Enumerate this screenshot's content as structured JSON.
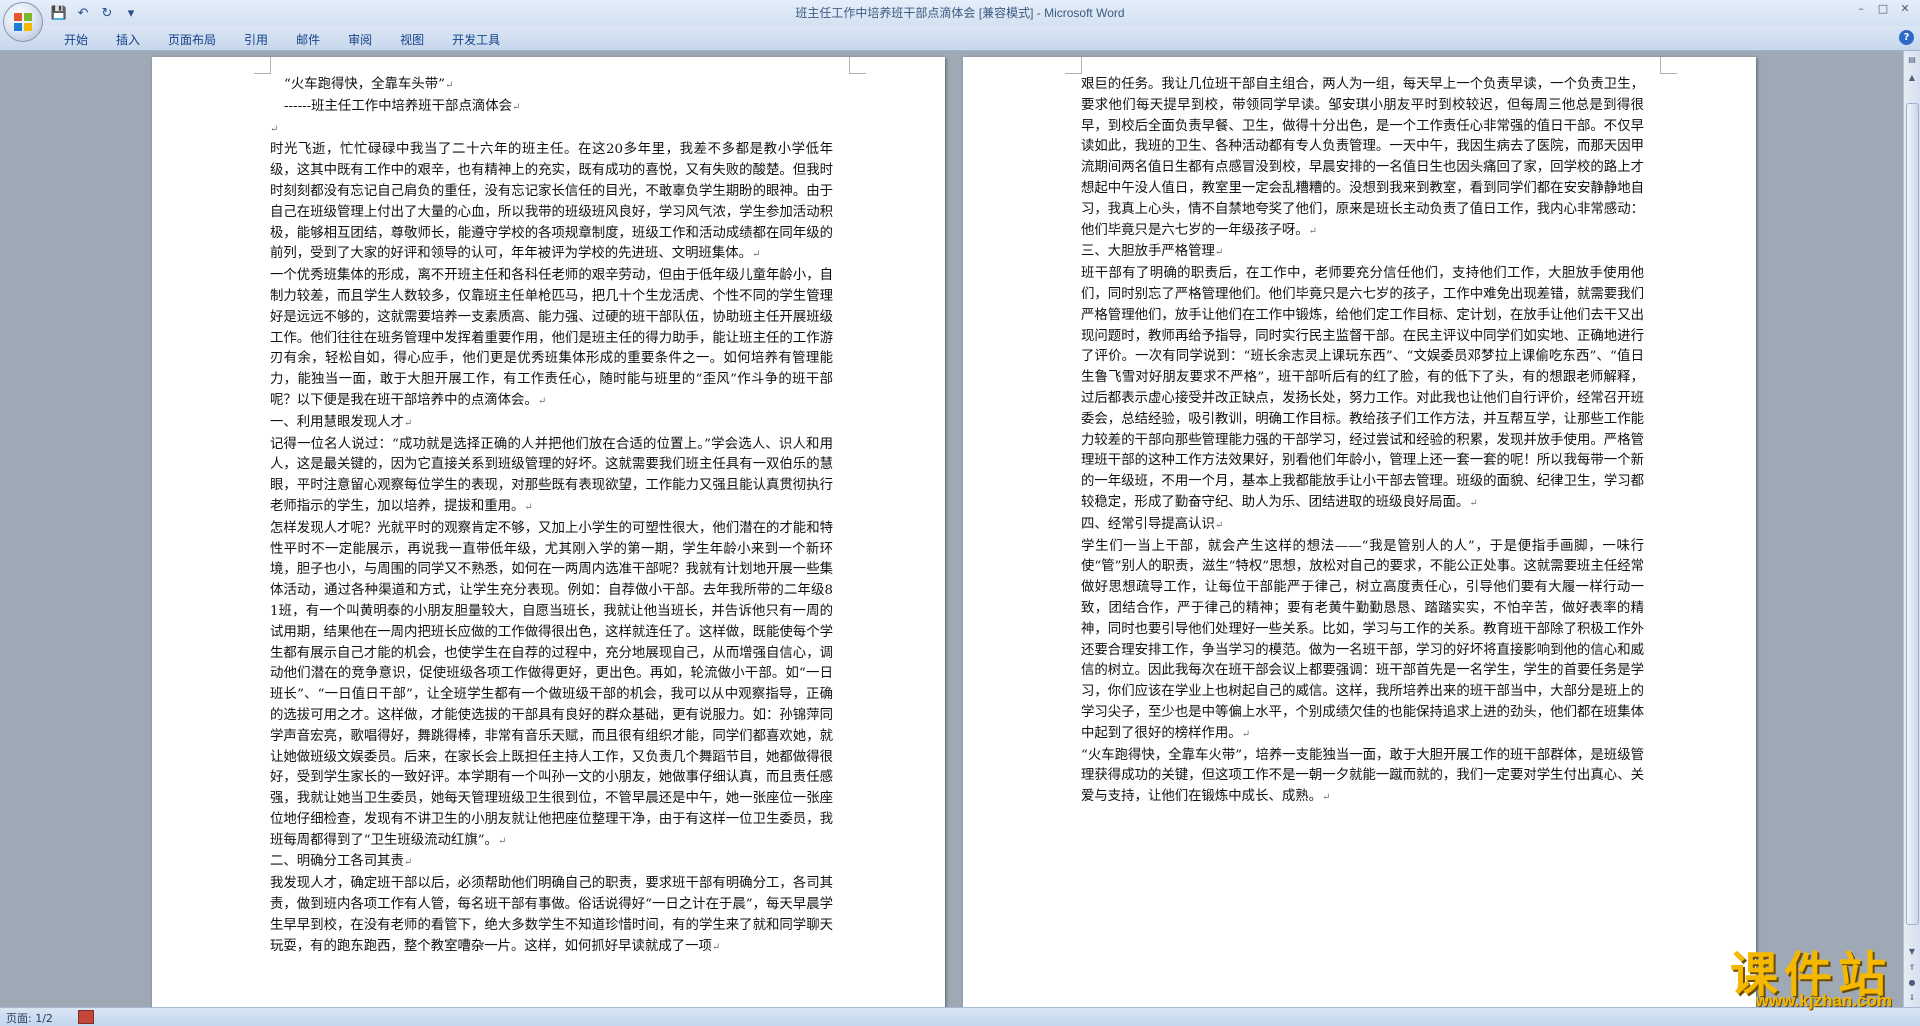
{
  "window": {
    "title_doc": "班主任工作中培养班干部点滴体会 [兼容模式] - ",
    "title_app": "Microsoft Word",
    "minimize": "–",
    "maximize": "□",
    "close": "✕"
  },
  "quick_access": [
    {
      "icon": "save-icon",
      "glyph": "💾"
    },
    {
      "icon": "undo-icon",
      "glyph": "↶"
    },
    {
      "icon": "redo-icon",
      "glyph": "↻"
    },
    {
      "icon": "customize-icon",
      "glyph": "▾"
    }
  ],
  "ribbon": {
    "tabs": [
      "开始",
      "插入",
      "页面布局",
      "引用",
      "邮件",
      "审阅",
      "视图",
      "开发工具"
    ],
    "help": "?"
  },
  "page1": {
    "paragraphs": [
      "“火车跑得快，全靠车头带”",
      "------班主任工作中培养班干部点滴体会",
      "",
      "时光飞逝，忙忙碌碌中我当了二十六年的班主任。在这20多年里，我差不多都是教小学低年级，这其中既有工作中的艰辛，也有精神上的充实，既有成功的喜悦，又有失败的酸楚。但我时时刻刻都没有忘记自己肩负的重任，没有忘记家长信任的目光，不敢辜负学生期盼的眼神。由于自己在班级管理上付出了大量的心血，所以我带的班级班风良好，学习风气浓，学生参加活动积极，能够相互团结，尊敬师长，能遵守学校的各项规章制度，班级工作和活动成绩都在同年级的前列，受到了大家的好评和领导的认可，年年被评为学校的先进班、文明班集体。",
      "一个优秀班集体的形成，离不开班主任和各科任老师的艰辛劳动，但由于低年级儿童年龄小，自制力较差，而且学生人数较多，仅靠班主任单枪匹马，把几十个生龙活虎、个性不同的学生管理好是远远不够的，这就需要培养一支素质高、能力强、过硬的班干部队伍，协助班主任开展班级工作。他们往往在班务管理中发挥着重要作用，他们是班主任的得力助手，能让班主任的工作游刃有余，轻松自如，得心应手，他们更是优秀班集体形成的重要条件之一。如何培养有管理能力，能独当一面，敢于大胆开展工作，有工作责任心，随时能与班里的“歪风”作斗争的班干部呢？以下便是我在班干部培养中的点滴体会。",
      "一、利用慧眼发现人才",
      "记得一位名人说过：“成功就是选择正确的人并把他们放在合适的位置上。”学会选人、识人和用人，这是最关键的，因为它直接关系到班级管理的好坏。这就需要我们班主任具有一双伯乐的慧眼，平时注意留心观察每位学生的表现，对那些既有表现欲望，工作能力又强且能认真贯彻执行老师指示的学生，加以培养，提拔和重用。",
      "怎样发现人才呢？光就平时的观察肯定不够，又加上小学生的可塑性很大，他们潜在的才能和特性平时不一定能展示，再说我一直带低年级，尤其刚入学的第一期，学生年龄小来到一个新环境，胆子也小，与周围的同学又不熟悉，如何在一两周内选准干部呢？我就有计划地开展一些集体活动，通过各种渠道和方式，让学生充分表现。例如：自荐做小干部。去年我所带的二年级81班，有一个叫黄明泰的小朋友胆量较大，自愿当班长，我就让他当班长，并告诉他只有一周的试用期，结果他在一周内把班长应做的工作做得很出色，这样就连任了。这样做，既能使每个学生都有展示自己才能的机会，也使学生在自荐的过程中，充分地展现自己，从而增强自信心，调动他们潜在的竞争意识，促使班级各项工作做得更好，更出色。再如，轮流做小干部。如“一日班长”、“一日值日干部”，让全班学生都有一个做班级干部的机会，我可以从中观察指导，正确的选拔可用之才。这样做，才能使选拔的干部具有良好的群众基础，更有说服力。如：孙锦萍同学声音宏亮，歌唱得好，舞跳得棒，非常有音乐天赋，而且很有组织才能，同学们都喜欢她，就让她做班级文娱委员。后来，在家长会上既担任主持人工作，又负责几个舞蹈节目，她都做得很好，受到学生家长的一致好评。本学期有一个叫孙一文的小朋友，她做事仔细认真，而且责任感强，我就让她当卫生委员，她每天管理班级卫生很到位，不管早晨还是中午，她一张座位一张座位地仔细检查，发现有不讲卫生的小朋友就让他把座位整理干净，由于有这样一位卫生委员，我班每周都得到了“卫生班级流动红旗”。",
      "二、明确分工各司其责",
      "我发现人才，确定班干部以后，必须帮助他们明确自己的职责，要求班干部有明确分工，各司其责，做到班内各项工作有人管，每名班干部有事做。俗话说得好“一日之计在于晨”，每天早晨学生早早到校，在没有老师的看管下，绝大多数学生不知道珍惜时间，有的学生来了就和同学聊天玩耍，有的跑东跑西，整个教室嘈杂一片。这样，如何抓好早读就成了一项"
    ]
  },
  "page2": {
    "paragraphs": [
      "艰巨的任务。我让几位班干部自主组合，两人为一组，每天早上一个负责早读，一个负责卫生，要求他们每天提早到校，带领同学早读。邹安琪小朋友平时到校较迟，但每周三他总是到得很早，到校后全面负责早餐、卫生，做得十分出色，是一个工作责任心非常强的值日干部。不仅早读如此，我班的卫生、各种活动都有专人负责管理。一天中午，我因生病去了医院，而那天因甲流期间两名值日生都有点感冒没到校，早晨安排的一名值日生也因头痛回了家，回学校的路上才想起中午没人值日，教室里一定会乱糟糟的。没想到我来到教室，看到同学们都在安安静静地自习，我真上心头，情不自禁地夸奖了他们，原来是班长主动负责了值日工作，我内心非常感动：他们毕竟只是六七岁的一年级孩子呀。",
      "三、大胆放手严格管理",
      "班干部有了明确的职责后，在工作中，老师要充分信任他们，支持他们工作，大胆放手使用他们，同时别忘了严格管理他们。他们毕竟只是六七岁的孩子，工作中难免出现差错，就需要我们严格管理他们，放手让他们在工作中锻炼，给他们定工作目标、定计划，在放手让他们去干又出现问题时，教师再给予指导，同时实行民主监督干部。在民主评议中同学们如实地、正确地进行了评价。一次有同学说到：“班长余志灵上课玩东西”、“文娱委员邓梦拉上课偷吃东西”、“值日生鲁飞雪对好朋友要求不严格”，班干部听后有的红了脸，有的低下了头，有的想跟老师解释，过后都表示虚心接受并改正缺点，发扬长处，努力工作。对此我也让他们自行评价，经常召开班委会，总结经验，吸引教训，明确工作目标。教给孩子们工作方法，并互帮互学，让那些工作能力较差的干部向那些管理能力强的干部学习，经过尝试和经验的积累，发现并放手使用。严格管理班干部的这种工作方法效果好，别看他们年龄小，管理上还一套一套的呢！所以我每带一个新的一年级班，不用一个月，基本上我都能放手让小干部去管理。班级的面貌、纪律卫生，学习都较稳定，形成了勤奋守纪、助人为乐、团结进取的班级良好局面。",
      "四、经常引导提高认识",
      "学生们一当上干部，就会产生这样的想法——“我是管别人的人”，于是便指手画脚，一味行使“管”别人的职责，滋生“特权”思想，放松对自己的要求，不能公正处事。这就需要班主任经常做好思想疏导工作，让每位干部能严于律己，树立高度责任心，引导他们要有大履一样行动一致，团结合作，严于律己的精神；要有老黄牛勤勤恳恳、踏踏实实，不怕辛苦，做好表率的精神，同时也要引导他们处理好一些关系。比如，学习与工作的关系。教育班干部除了积极工作外还要合理安排工作，争当学习的模范。做为一名班干部，学习的好坏将直接影响到他的信心和威信的树立。因此我每次在班干部会议上都要强调：班干部首先是一名学生，学生的首要任务是学习，你们应该在学业上也树起自己的威信。这样，我所培养出来的班干部当中，大部分是班上的学习尖子，至少也是中等偏上水平，个别成绩欠佳的也能保持追求上进的劲头，他们都在班集体中起到了很好的榜样作用。",
      "“火车跑得快，全靠车火带”，培养一支能独当一面，敢于大胆开展工作的班干部群体，是班级管理获得成功的关键，但这项工作不是一朝一夕就能一蹴而就的，我们一定要对学生付出真心、关爱与支持，让他们在锻炼中成长、成熟。"
    ]
  },
  "status": {
    "page_indicator": "页面: 1/2"
  },
  "watermark": {
    "name": "课件站",
    "url": "www.kjzhan.com"
  }
}
